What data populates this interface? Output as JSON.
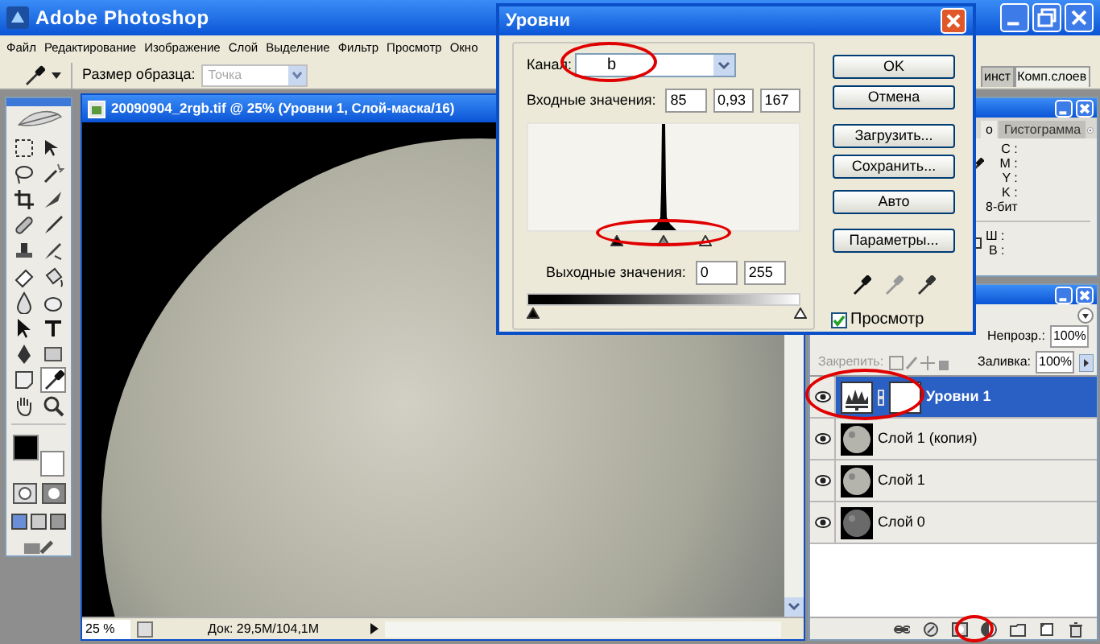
{
  "app_title": "Adobe Photoshop",
  "menu": [
    "Файл",
    "Редактирование",
    "Изображение",
    "Слой",
    "Выделение",
    "Фильтр",
    "Просмотр",
    "Окно"
  ],
  "options_bar": {
    "sample_size_label": "Размер образца:",
    "sample_size_value": "Точка"
  },
  "document": {
    "title": "20090904_2rgb.tif @ 25% (Уровни 1, Слой-маска/16)",
    "zoom": "25 %",
    "doc_info": "Док: 29,5M/104,1M"
  },
  "panel_tabs": [
    {
      "label": "инст",
      "selected": false
    },
    {
      "label": "Комп.слоев",
      "selected": true
    }
  ],
  "info_panel": {
    "tabs": [
      {
        "label": "о",
        "selected": true
      },
      {
        "label": "Гистограмма",
        "selected": false
      }
    ],
    "cmyk_labels": [
      "C :",
      "M :",
      "Y :",
      "K :"
    ],
    "bit_depth": "8-бит",
    "size_labels": [
      "Ш :",
      "В :"
    ]
  },
  "layers_panel": {
    "opacity_label": "Непрозр.:",
    "opacity": "100%",
    "lock_label": "Закрепить:",
    "fill_label": "Заливка:",
    "fill": "100%",
    "layers": [
      {
        "name": "Уровни 1",
        "kind": "adjustment",
        "selected": true,
        "visible": true
      },
      {
        "name": "Слой 1 (копия)",
        "kind": "image",
        "selected": false,
        "visible": true
      },
      {
        "name": "Слой 1",
        "kind": "image",
        "selected": false,
        "visible": true
      },
      {
        "name": "Слой 0",
        "kind": "dark-image",
        "selected": false,
        "visible": true
      }
    ]
  },
  "levels_dialog": {
    "title": "Уровни",
    "channel_label": "Канал:",
    "channel": "b",
    "input_label": "Входные значения:",
    "input_values": [
      "85",
      "0,93",
      "167"
    ],
    "input_sliders": [
      {
        "level": 0.33
      },
      {
        "level": 0.5
      },
      {
        "level": 0.65
      }
    ],
    "output_label": "Выходные значения:",
    "output_values": [
      "0",
      "255"
    ],
    "output_sliders": [
      {
        "level": 0
      },
      {
        "level": 1
      }
    ],
    "buttons": [
      "OK",
      "Отмена",
      "Загрузить...",
      "Сохранить...",
      "Авто",
      "Параметры..."
    ],
    "preview": {
      "label": "Просмотр",
      "checked": true
    }
  }
}
